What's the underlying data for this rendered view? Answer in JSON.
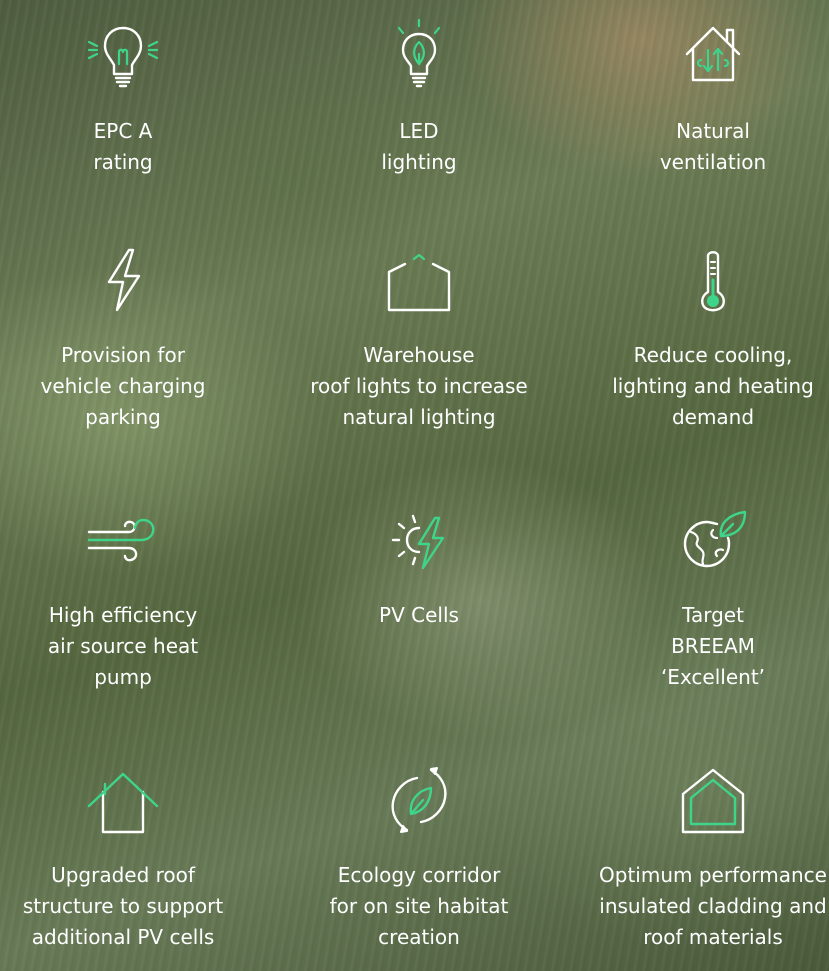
{
  "colors": {
    "text": "#ffffff",
    "accent": "#3ed58a"
  },
  "features": [
    {
      "icon": "light-bulb-icon",
      "lines": [
        "EPC A",
        "rating"
      ]
    },
    {
      "icon": "led-bulb-icon",
      "lines": [
        "LED",
        "lighting"
      ]
    },
    {
      "icon": "ventilation-house-icon",
      "lines": [
        "Natural",
        "ventilation"
      ]
    },
    {
      "icon": "lightning-bolt-icon",
      "lines": [
        "Provision for",
        "vehicle charging",
        "parking"
      ]
    },
    {
      "icon": "warehouse-roof-icon",
      "lines": [
        "Warehouse",
        "roof lights to increase",
        "natural lighting"
      ]
    },
    {
      "icon": "thermometer-icon",
      "lines": [
        "Reduce cooling,",
        "lighting and heating",
        "demand"
      ]
    },
    {
      "icon": "wind-icon",
      "lines": [
        "High efficiency",
        "air source heat",
        "pump"
      ]
    },
    {
      "icon": "solar-power-icon",
      "lines": [
        "PV Cells"
      ]
    },
    {
      "icon": "globe-leaf-icon",
      "lines": [
        "Target",
        "BREEAM",
        "‘Excellent’"
      ]
    },
    {
      "icon": "roof-structure-icon",
      "lines": [
        "Upgraded roof",
        "structure to support",
        "additional PV cells"
      ]
    },
    {
      "icon": "eco-cycle-icon",
      "lines": [
        "Ecology corridor",
        "for on site habitat",
        "creation"
      ]
    },
    {
      "icon": "insulated-house-icon",
      "lines": [
        "Optimum performance",
        "insulated cladding and",
        "roof materials"
      ]
    }
  ]
}
